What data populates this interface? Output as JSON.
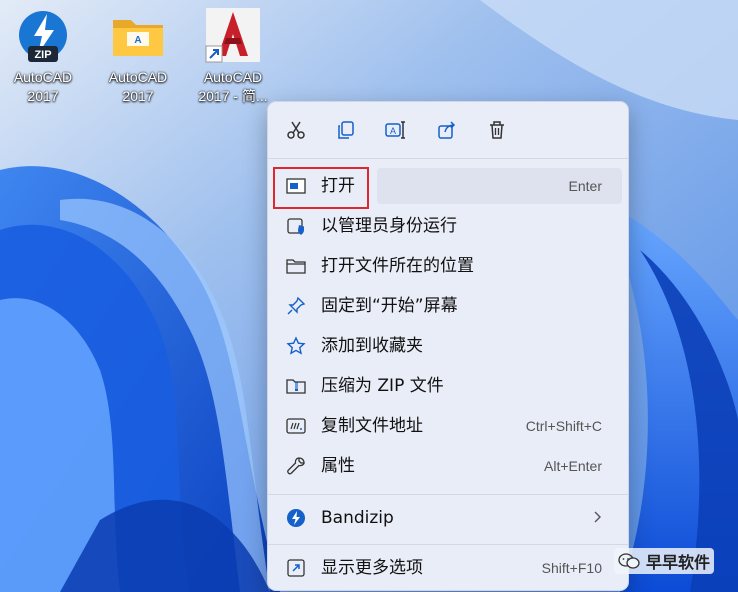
{
  "desktop": {
    "icons": [
      {
        "label_line1": "AutoCAD",
        "label_line2": "2017",
        "icon": "zip-archive-icon"
      },
      {
        "label_line1": "AutoCAD",
        "label_line2": "2017",
        "icon": "folder-icon"
      },
      {
        "label_line1": "AutoCAD",
        "label_line2": "2017 - 简...",
        "icon": "autocad-shortcut-icon"
      }
    ]
  },
  "context_menu": {
    "quick_actions": [
      {
        "name": "cut",
        "icon": "scissors-icon"
      },
      {
        "name": "copy",
        "icon": "copy-icon"
      },
      {
        "name": "rename",
        "icon": "rename-icon"
      },
      {
        "name": "share",
        "icon": "share-icon"
      },
      {
        "name": "delete",
        "icon": "trash-icon"
      }
    ],
    "items": [
      {
        "label": "打开",
        "shortcut": "Enter",
        "icon": "open-window-icon"
      },
      {
        "label": "以管理员身份运行",
        "shortcut": "",
        "icon": "shield-icon"
      },
      {
        "label": "打开文件所在的位置",
        "shortcut": "",
        "icon": "folder-icon"
      },
      {
        "label": "固定到“开始”屏幕",
        "shortcut": "",
        "icon": "pin-icon"
      },
      {
        "label": "添加到收藏夹",
        "shortcut": "",
        "icon": "star-icon"
      },
      {
        "label": "压缩为 ZIP 文件",
        "shortcut": "",
        "icon": "zip-icon"
      },
      {
        "label": "复制文件地址",
        "shortcut": "Ctrl+Shift+C",
        "icon": "copy-path-icon"
      },
      {
        "label": "属性",
        "shortcut": "Alt+Enter",
        "icon": "wrench-icon"
      },
      {
        "label": "Bandizip",
        "shortcut": "",
        "icon": "bandizip-icon",
        "submenu": true
      },
      {
        "label": "显示更多选项",
        "shortcut": "Shift+F10",
        "icon": "more-options-icon"
      }
    ],
    "highlight_color": "#e0262e"
  },
  "watermark": {
    "text": "早早软件"
  }
}
